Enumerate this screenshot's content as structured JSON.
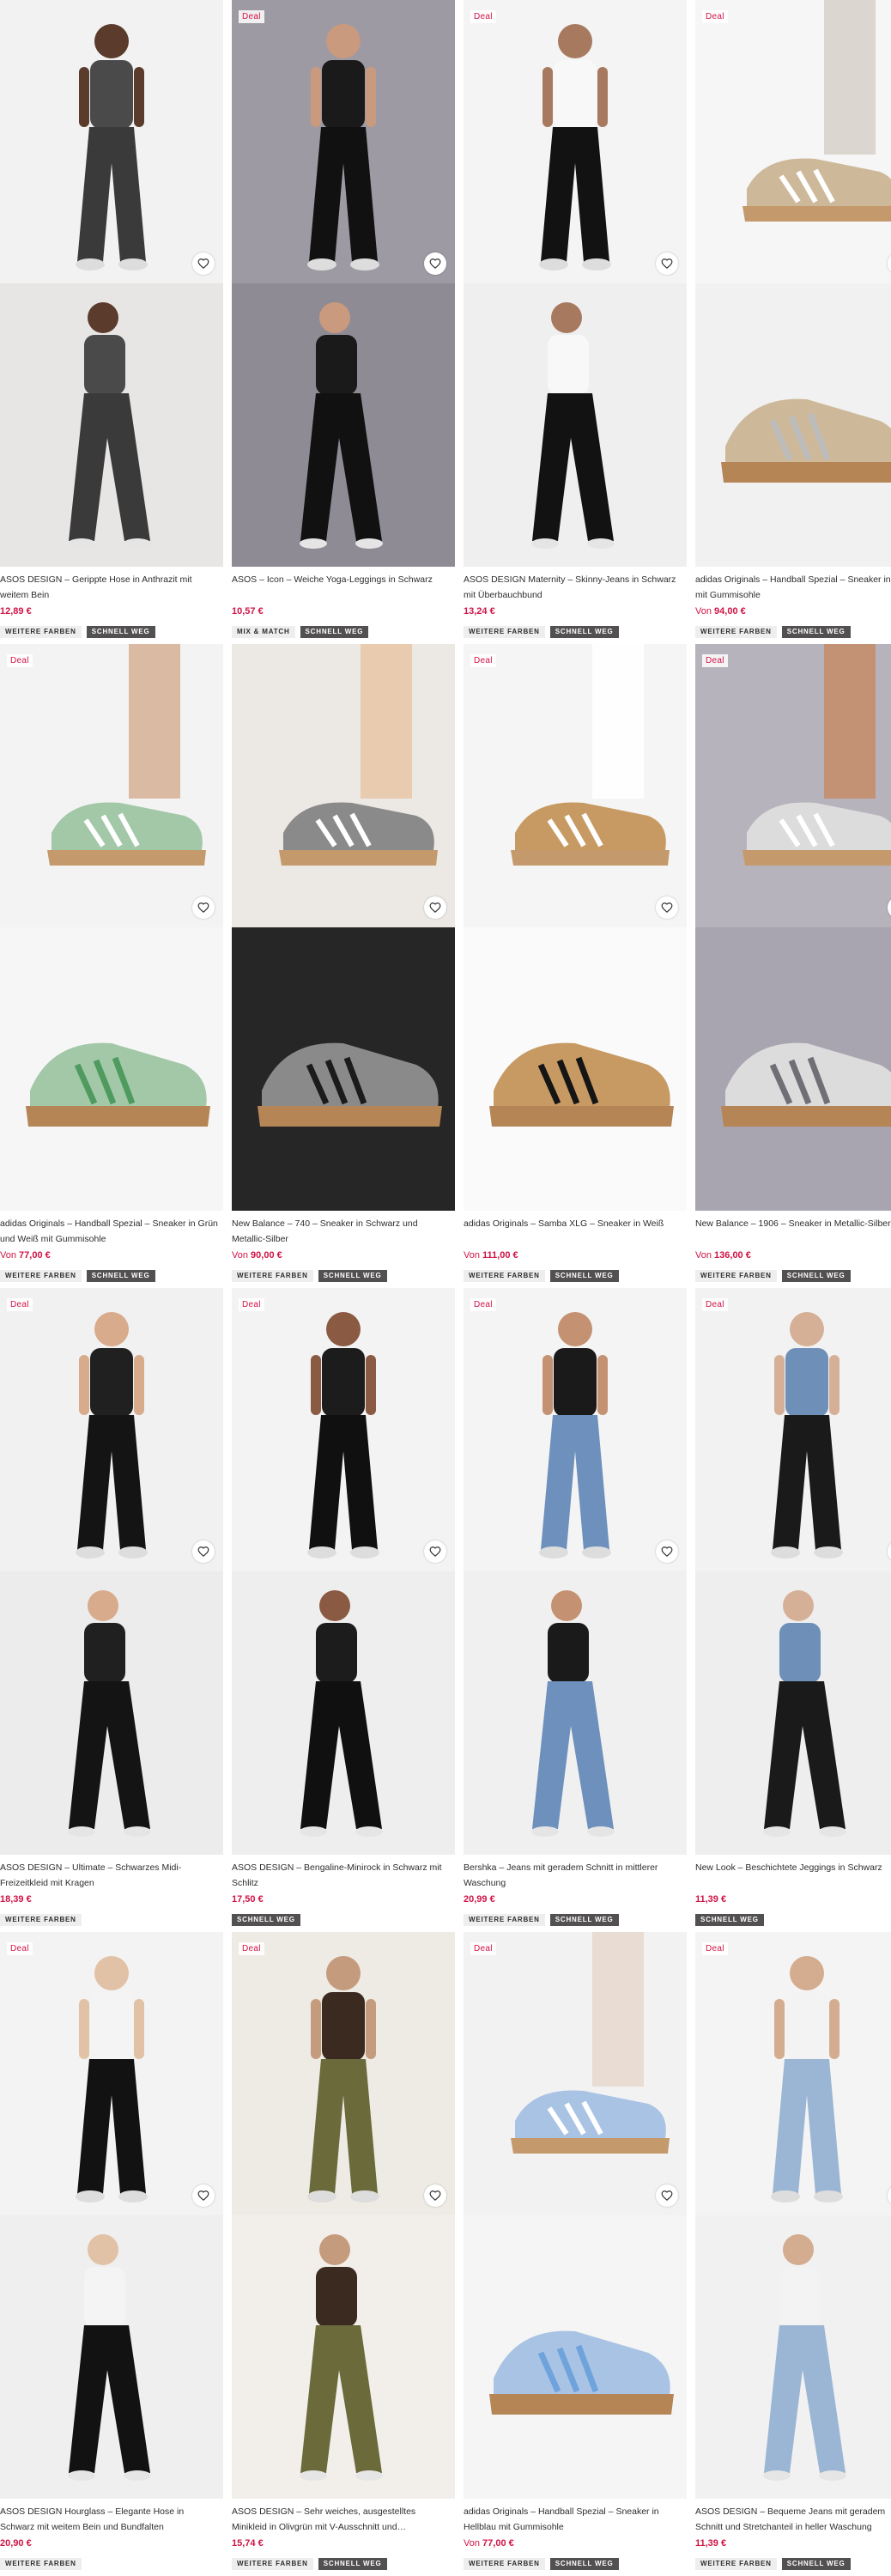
{
  "labels": {
    "deal": "Deal",
    "from": "Von"
  },
  "colors": {
    "price": "#d01345",
    "deal": "#d01345",
    "tag_dark": "#525050",
    "tag_light": "#eeeeee"
  },
  "products": [
    {
      "deal": false,
      "title": "ASOS DESIGN – Gerippte Hose in Anthrazit mit weitem Bein",
      "price_prefix": "",
      "price": "12,89 €",
      "tags": [
        {
          "label": "WEITERE FARBEN",
          "style": "light"
        },
        {
          "label": "SCHNELL WEG",
          "style": "dark"
        }
      ],
      "img": {
        "bg1": "#f2f2f2",
        "bg2": "#e8e6e4",
        "fig": "#3a3a3a",
        "fig2": "#4a4a4a",
        "skin": "#5a3b2c",
        "kind": "person"
      }
    },
    {
      "deal": true,
      "title": "ASOS – Icon – Weiche Yoga-Leggings in Schwarz",
      "price_prefix": "",
      "price": "10,57 €",
      "tags": [
        {
          "label": "MIX & MATCH",
          "style": "light"
        },
        {
          "label": "SCHNELL WEG",
          "style": "dark"
        }
      ],
      "img": {
        "bg1": "#9e9aa3",
        "bg2": "#8f8b95",
        "fig": "#111",
        "fig2": "#1a1a1a",
        "skin": "#c99a7e",
        "kind": "person"
      }
    },
    {
      "deal": true,
      "title": "ASOS DESIGN Maternity – Skinny-Jeans in Schwarz mit Überbauchbund",
      "price_prefix": "",
      "price": "13,24 €",
      "tags": [
        {
          "label": "WEITERE FARBEN",
          "style": "light"
        },
        {
          "label": "SCHNELL WEG",
          "style": "dark"
        }
      ],
      "img": {
        "bg1": "#f4f4f4",
        "bg2": "#efefef",
        "fig": "#121212",
        "fig2": "#f8f8f8",
        "skin": "#a77a60",
        "kind": "person"
      }
    },
    {
      "deal": true,
      "title": "adidas Originals – Handball Spezial – Sneaker in Grau mit Gummisohle",
      "price_prefix": "Von",
      "price": "94,00 €",
      "tags": [
        {
          "label": "WEITERE FARBEN",
          "style": "light"
        },
        {
          "label": "SCHNELL WEG",
          "style": "dark"
        }
      ],
      "img": {
        "bg1": "#f6f6f6",
        "bg2": "#f1f1f1",
        "fig": "#bcbcbc",
        "fig2": "#cdb99a",
        "skin": "#d8d3cb",
        "kind": "shoe"
      }
    },
    {
      "deal": true,
      "title": "adidas Originals – Handball Spezial – Sneaker in Grün und Weiß mit Gummisohle",
      "price_prefix": "Von",
      "price": "77,00 €",
      "tags": [
        {
          "label": "WEITERE FARBEN",
          "style": "light"
        },
        {
          "label": "SCHNELL WEG",
          "style": "dark"
        }
      ],
      "img": {
        "bg1": "#f3f3f3",
        "bg2": "#f6f6f6",
        "fig": "#4e9a5f",
        "fig2": "#a2c8a8",
        "skin": "#d8b49a",
        "kind": "shoe"
      }
    },
    {
      "deal": false,
      "title": "New Balance – 740 – Sneaker in Schwarz und Metallic-Silber",
      "price_prefix": "Von",
      "price": "90,00 €",
      "tags": [
        {
          "label": "WEITERE FARBEN",
          "style": "light"
        },
        {
          "label": "SCHNELL WEG",
          "style": "dark"
        }
      ],
      "img": {
        "bg1": "#ece8e4",
        "bg2": "#262626",
        "fig": "#1b1b1b",
        "fig2": "#8a8a8a",
        "skin": "#e9c8a8",
        "kind": "shoe"
      }
    },
    {
      "deal": true,
      "title": "adidas Originals – Samba XLG – Sneaker in Weiß",
      "price_prefix": "Von",
      "price": "111,00 €",
      "tags": [
        {
          "label": "WEITERE FARBEN",
          "style": "light"
        },
        {
          "label": "SCHNELL WEG",
          "style": "dark"
        }
      ],
      "img": {
        "bg1": "#f5f5f5",
        "bg2": "#fafafa",
        "fig": "#151515",
        "fig2": "#c89a63",
        "skin": "#ffffff",
        "kind": "shoe"
      }
    },
    {
      "deal": true,
      "title": "New Balance – 1906 – Sneaker in Metallic-Silber",
      "price_prefix": "Von",
      "price": "136,00 €",
      "tags": [
        {
          "label": "WEITERE FARBEN",
          "style": "light"
        },
        {
          "label": "SCHNELL WEG",
          "style": "dark"
        }
      ],
      "img": {
        "bg1": "#b7b3bc",
        "bg2": "#a9a5b0",
        "fig": "#6f6f76",
        "fig2": "#dcdcdc",
        "skin": "#c48d6c",
        "kind": "shoe"
      }
    },
    {
      "deal": true,
      "title": "ASOS DESIGN – Ultimate – Schwarzes Midi-Freizeitkleid mit Kragen",
      "price_prefix": "",
      "price": "18,39 €",
      "tags": [
        {
          "label": "WEITERE FARBEN",
          "style": "light"
        }
      ],
      "img": {
        "bg1": "#f1f1f1",
        "bg2": "#ececec",
        "fig": "#141414",
        "fig2": "#202020",
        "skin": "#d7ab8c",
        "kind": "person"
      }
    },
    {
      "deal": true,
      "title": "ASOS DESIGN – Bengaline-Minirock in Schwarz mit Schlitz",
      "price_prefix": "",
      "price": "17,50 €",
      "tags": [
        {
          "label": "SCHNELL WEG",
          "style": "dark"
        }
      ],
      "img": {
        "bg1": "#f3f3f3",
        "bg2": "#eeeeee",
        "fig": "#101010",
        "fig2": "#1c1c1c",
        "skin": "#8a5a42",
        "kind": "person"
      }
    },
    {
      "deal": true,
      "title": "Bershka – Jeans mit geradem Schnitt in mittlerer Waschung",
      "price_prefix": "",
      "price": "20,99 €",
      "tags": [
        {
          "label": "WEITERE FARBEN",
          "style": "light"
        },
        {
          "label": "SCHNELL WEG",
          "style": "dark"
        }
      ],
      "img": {
        "bg1": "#f4f4f4",
        "bg2": "#f0f0f0",
        "fig": "#6d90bc",
        "fig2": "#1a1a1a",
        "skin": "#c49272",
        "kind": "person"
      }
    },
    {
      "deal": true,
      "title": "New Look – Beschichtete Jeggings in Schwarz",
      "price_prefix": "",
      "price": "11,39 €",
      "tags": [
        {
          "label": "SCHNELL WEG",
          "style": "dark"
        }
      ],
      "img": {
        "bg1": "#f2f2f2",
        "bg2": "#eeeeee",
        "fig": "#1a1a1a",
        "fig2": "#6d8fb8",
        "skin": "#d6b096",
        "kind": "person"
      }
    },
    {
      "deal": true,
      "title": "ASOS DESIGN Hourglass – Elegante Hose in Schwarz mit weitem Bein und Bundfalten",
      "price_prefix": "",
      "price": "20,90 €",
      "tags": [
        {
          "label": "WEITERE FARBEN",
          "style": "light"
        }
      ],
      "img": {
        "bg1": "#f3f3f3",
        "bg2": "#efefef",
        "fig": "#121212",
        "fig2": "#f4f4f4",
        "skin": "#e2c2a6",
        "kind": "person"
      }
    },
    {
      "deal": true,
      "title": "ASOS DESIGN – Sehr weiches, ausgestelltes Minikleid in Olivgrün mit V-Ausschnitt und…",
      "price_prefix": "",
      "price": "15,74 €",
      "tags": [
        {
          "label": "WEITERE FARBEN",
          "style": "light"
        },
        {
          "label": "SCHNELL WEG",
          "style": "dark"
        }
      ],
      "img": {
        "bg1": "#eeeae4",
        "bg2": "#f2efea",
        "fig": "#6a6a3b",
        "fig2": "#3a2a20",
        "skin": "#c59b7d",
        "kind": "person"
      }
    },
    {
      "deal": true,
      "title": "adidas Originals – Handball Spezial – Sneaker in Hellblau mit Gummisohle",
      "price_prefix": "Von",
      "price": "77,00 €",
      "tags": [
        {
          "label": "WEITERE FARBEN",
          "style": "light"
        },
        {
          "label": "SCHNELL WEG",
          "style": "dark"
        }
      ],
      "img": {
        "bg1": "#f2f2f2",
        "bg2": "#f5f5f5",
        "fig": "#6fa3dc",
        "fig2": "#a9c3e4",
        "skin": "#e7d9cf",
        "kind": "shoe"
      }
    },
    {
      "deal": true,
      "title": "ASOS DESIGN – Bequeme Jeans mit geradem Schnitt und Stretchanteil in heller Waschung",
      "price_prefix": "",
      "price": "11,39 €",
      "tags": [
        {
          "label": "WEITERE FARBEN",
          "style": "light"
        },
        {
          "label": "SCHNELL WEG",
          "style": "dark"
        }
      ],
      "img": {
        "bg1": "#f4f4f4",
        "bg2": "#f1f1f1",
        "fig": "#9bb6d4",
        "fig2": "#f3f3f3",
        "skin": "#d4ac8f",
        "kind": "person"
      }
    }
  ]
}
